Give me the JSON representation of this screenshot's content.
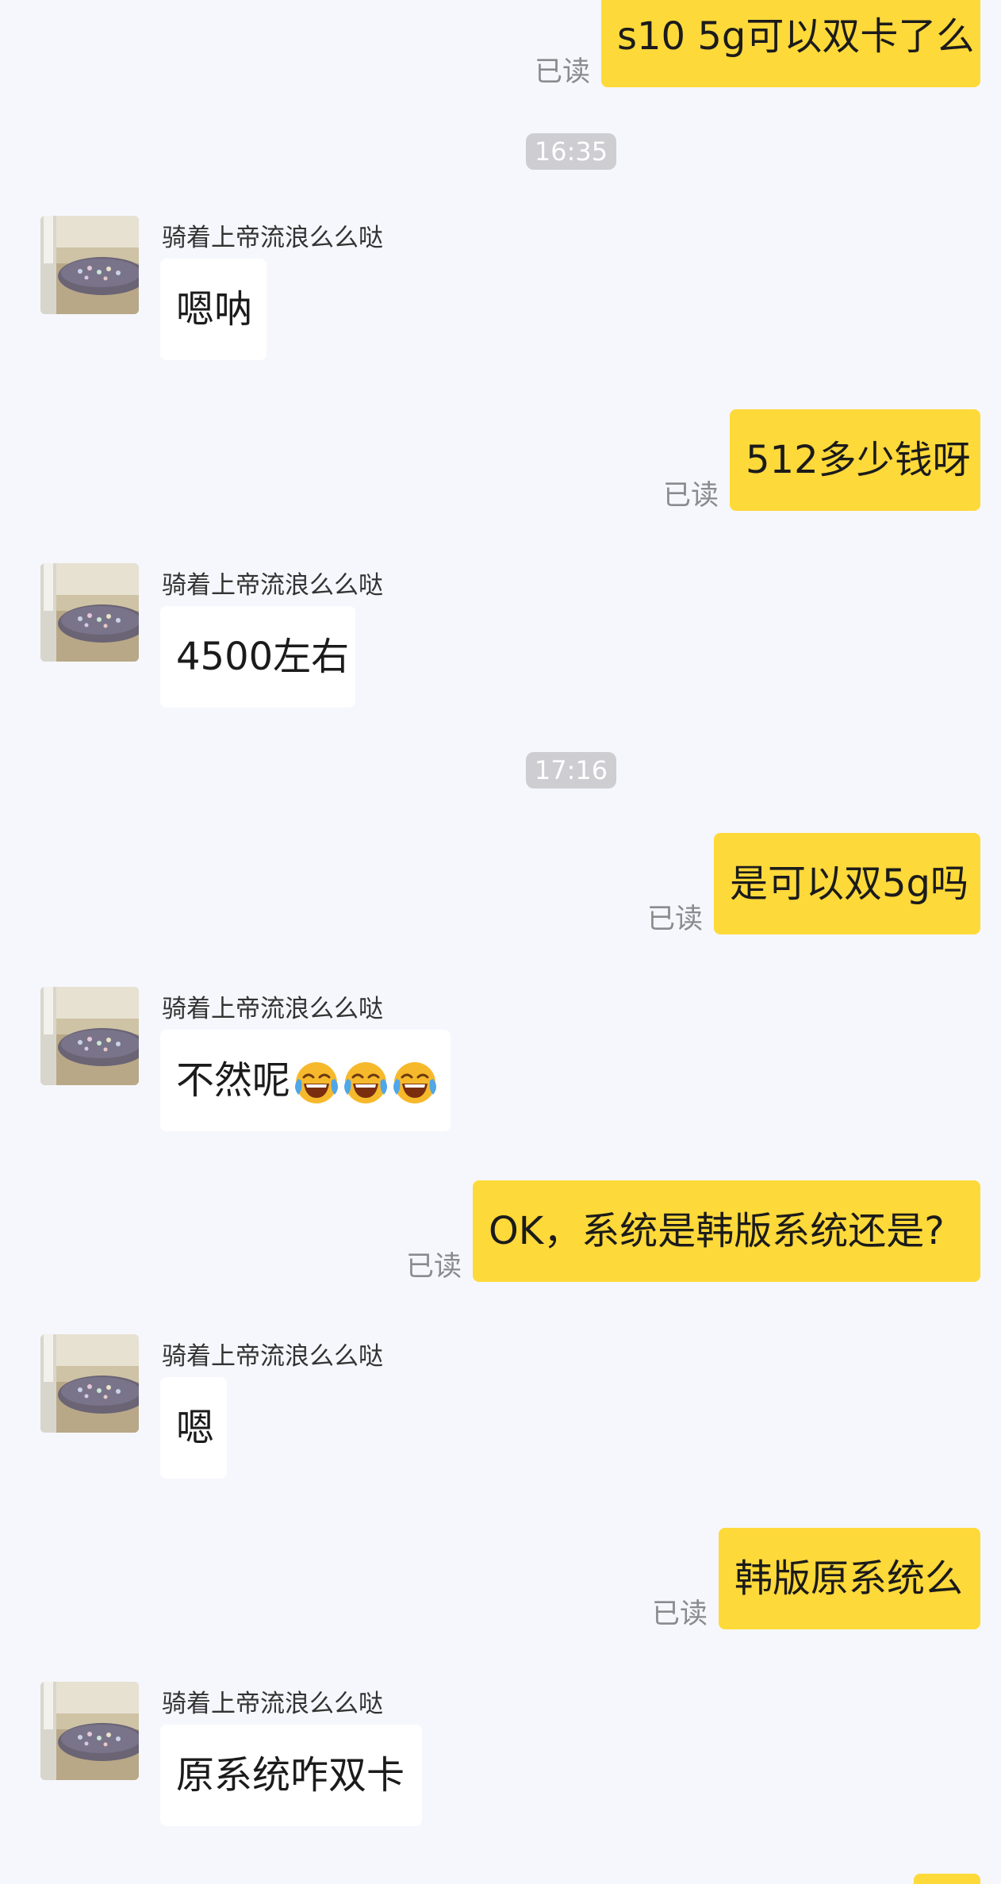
{
  "read_label": "已读",
  "sender_name": "骑着上帝流浪么么哒",
  "messages": {
    "m1": "s10 5g可以双卡了么",
    "m2": "嗯呐",
    "m3": "512多少钱呀",
    "m4": "4500左右",
    "m5": "是可以双5g吗",
    "m6": "不然呢",
    "m7": "OK，系统是韩版系统还是?",
    "m8": "嗯",
    "m9": "韩版原系统么",
    "m10": "原系统咋双卡"
  },
  "timestamps": [
    "16:35",
    "17:16"
  ],
  "emoji": {
    "m6": [
      "laughing-crying-emoji",
      "laughing-crying-emoji",
      "laughing-crying-emoji"
    ]
  },
  "colors": {
    "background": "#F6F7FC",
    "outgoing_bubble": "#FED93A",
    "incoming_bubble": "#FFFFFF",
    "timestamp_bg": "#CDCDD2",
    "read_text": "#8A8A8F"
  }
}
